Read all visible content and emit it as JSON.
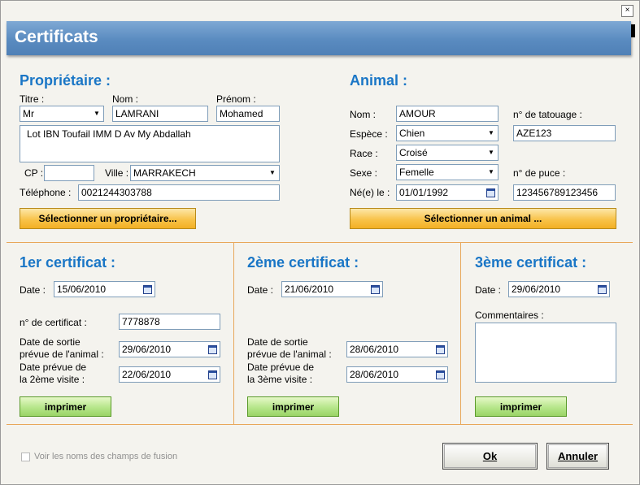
{
  "window": {
    "title": "Certificats",
    "close_glyph": "×"
  },
  "owner": {
    "section_title": "Propriétaire :",
    "titre_label": "Titre :",
    "titre_value": "Mr",
    "nom_label": "Nom :",
    "nom_value": "LAMRANI",
    "prenom_label": "Prénom :",
    "prenom_value": "Mohamed",
    "address": "Lot IBN Toufail IMM D Av My Abdallah",
    "cp_label": "CP :",
    "cp_value": "",
    "ville_label": "Ville :",
    "ville_value": "MARRAKECH",
    "tel_label": "Téléphone :",
    "tel_value": "0021244303788",
    "select_button": "Sélectionner un propriétaire..."
  },
  "animal": {
    "section_title": "Animal :",
    "nom_label": "Nom :",
    "nom_value": "AMOUR",
    "tatouage_label": "n° de tatouage :",
    "tatouage_value": "AZE123",
    "espece_label": "Espèce :",
    "espece_value": "Chien",
    "race_label": "Race :",
    "race_value": "Croisé",
    "sexe_label": "Sexe :",
    "sexe_value": "Femelle",
    "puce_label": "n° de puce :",
    "puce_value": "123456789123456",
    "ne_label": "Né(e) le :",
    "ne_value": "01/01/1992",
    "select_button": "Sélectionner un animal ..."
  },
  "cert1": {
    "title": "1er certificat :",
    "date_label": "Date :",
    "date_value": "15/06/2010",
    "num_label": "n° de certificat :",
    "num_value": "7778878",
    "sortie_label_1": "Date de sortie",
    "sortie_label_2": "prévue de l'animal :",
    "sortie_value": "29/06/2010",
    "visite_label_1": "Date prévue de",
    "visite_label_2": "la 2ème visite :",
    "visite_value": "22/06/2010",
    "print_button": "imprimer"
  },
  "cert2": {
    "title": "2ème certificat :",
    "date_label": "Date :",
    "date_value": "21/06/2010",
    "sortie_label_1": "Date de sortie",
    "sortie_label_2": "prévue de l'animal :",
    "sortie_value": "28/06/2010",
    "visite_label_1": "Date prévue de",
    "visite_label_2": "la 3ème visite :",
    "visite_value": "28/06/2010",
    "print_button": "imprimer"
  },
  "cert3": {
    "title": "3ème certificat :",
    "date_label": "Date :",
    "date_value": "29/06/2010",
    "comments_label": "Commentaires :",
    "comments_value": "",
    "print_button": "imprimer"
  },
  "footer": {
    "merge_fields_label": "Voir les noms des champs de fusion",
    "ok_button": "Ok",
    "cancel_button": "Annuler"
  },
  "icons": {
    "dropdown": "chevron-down-icon",
    "calendar": "calendar-icon"
  },
  "colors": {
    "accent_title": "#1a76c6",
    "header_blue": "#5a8bc0",
    "separator": "#e8a75a"
  }
}
